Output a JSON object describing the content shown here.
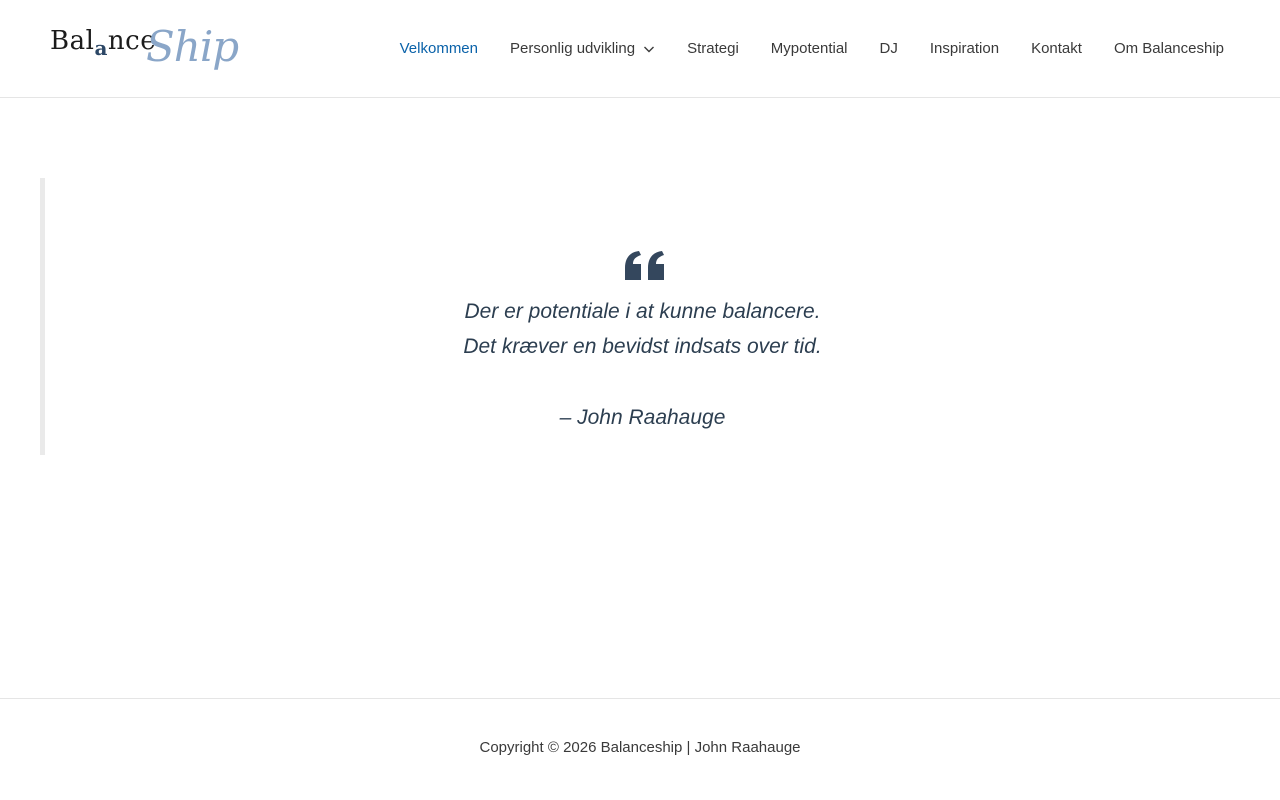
{
  "header": {
    "logo": {
      "part1": "Bal",
      "part2": "a",
      "part3": "nce",
      "script": "Ship"
    },
    "nav": [
      {
        "label": "Velkommen",
        "active": true
      },
      {
        "label": "Personlig udvikling",
        "has_dropdown": true
      },
      {
        "label": "Strategi"
      },
      {
        "label": "Mypotential"
      },
      {
        "label": "DJ"
      },
      {
        "label": "Inspiration"
      },
      {
        "label": "Kontakt"
      },
      {
        "label": "Om Balanceship"
      }
    ]
  },
  "quote": {
    "icon": "quote-icon",
    "lines": [
      "Der er potentiale i at kunne balancere.",
      "Det kræver en bevidst indsats over tid."
    ],
    "author": "– John Raahauge"
  },
  "footer": {
    "copyright": "Copyright © 2026 Balanceship | John Raahauge"
  },
  "colors": {
    "accent": "#0a62a9",
    "text": "#3a3a3a",
    "quote_text": "#2c3e50",
    "logo_script": "#8aa6c8"
  }
}
